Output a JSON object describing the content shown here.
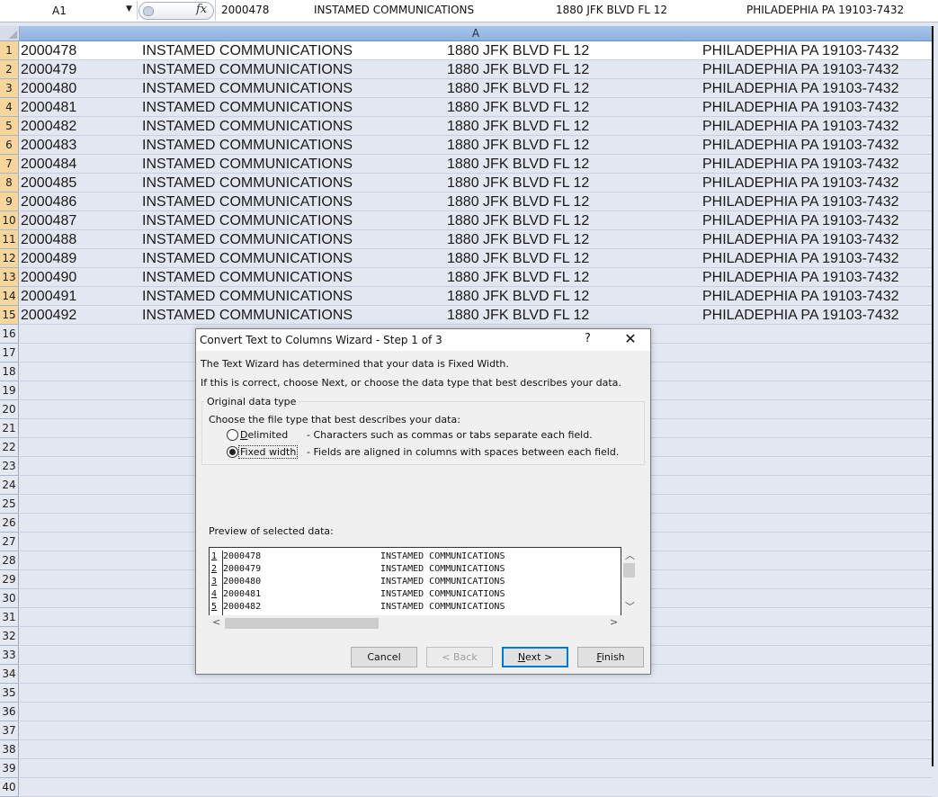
{
  "formula_bar": {
    "name_box": "A1",
    "fx_label": "fx",
    "content": {
      "id": "2000478",
      "company": "INSTAMED COMMUNICATIONS",
      "address": "1880 JFK BLVD FL 12",
      "city": "PHILADEPHIA PA 19103-7432"
    }
  },
  "sheet": {
    "column_header": "A",
    "row_numbers": [
      "1",
      "2",
      "3",
      "4",
      "5",
      "6",
      "7",
      "8",
      "9",
      "10",
      "11",
      "12",
      "13",
      "14",
      "15",
      "16",
      "17",
      "18",
      "19",
      "20",
      "21",
      "22",
      "23",
      "24",
      "25",
      "26",
      "27",
      "28",
      "29",
      "30",
      "31",
      "32",
      "33",
      "34",
      "35",
      "36",
      "37",
      "38",
      "39",
      "40"
    ],
    "rows": [
      {
        "id": "2000478",
        "company": "INSTAMED COMMUNICATIONS",
        "address": "1880 JFK BLVD FL 12",
        "city": "PHILADEPHIA PA 19103-7432"
      },
      {
        "id": "2000479",
        "company": "INSTAMED COMMUNICATIONS",
        "address": "1880 JFK BLVD FL 12",
        "city": "PHILADEPHIA PA 19103-7432"
      },
      {
        "id": "2000480",
        "company": "INSTAMED COMMUNICATIONS",
        "address": "1880 JFK BLVD FL 12",
        "city": "PHILADEPHIA PA 19103-7432"
      },
      {
        "id": "2000481",
        "company": "INSTAMED COMMUNICATIONS",
        "address": "1880 JFK BLVD FL 12",
        "city": "PHILADEPHIA PA 19103-7432"
      },
      {
        "id": "2000482",
        "company": "INSTAMED COMMUNICATIONS",
        "address": "1880 JFK BLVD FL 12",
        "city": "PHILADEPHIA PA 19103-7432"
      },
      {
        "id": "2000483",
        "company": "INSTAMED COMMUNICATIONS",
        "address": "1880 JFK BLVD FL 12",
        "city": "PHILADEPHIA PA 19103-7432"
      },
      {
        "id": "2000484",
        "company": "INSTAMED COMMUNICATIONS",
        "address": "1880 JFK BLVD FL 12",
        "city": "PHILADEPHIA PA 19103-7432"
      },
      {
        "id": "2000485",
        "company": "INSTAMED COMMUNICATIONS",
        "address": "1880 JFK BLVD FL 12",
        "city": "PHILADEPHIA PA 19103-7432"
      },
      {
        "id": "2000486",
        "company": "INSTAMED COMMUNICATIONS",
        "address": "1880 JFK BLVD FL 12",
        "city": "PHILADEPHIA PA 19103-7432"
      },
      {
        "id": "2000487",
        "company": "INSTAMED COMMUNICATIONS",
        "address": "1880 JFK BLVD FL 12",
        "city": "PHILADEPHIA PA 19103-7432"
      },
      {
        "id": "2000488",
        "company": "INSTAMED COMMUNICATIONS",
        "address": "1880 JFK BLVD FL 12",
        "city": "PHILADEPHIA PA 19103-7432"
      },
      {
        "id": "2000489",
        "company": "INSTAMED COMMUNICATIONS",
        "address": "1880 JFK BLVD FL 12",
        "city": "PHILADEPHIA PA 19103-7432"
      },
      {
        "id": "2000490",
        "company": "INSTAMED COMMUNICATIONS",
        "address": "1880 JFK BLVD FL 12",
        "city": "PHILADEPHIA PA 19103-7432"
      },
      {
        "id": "2000491",
        "company": "INSTAMED COMMUNICATIONS",
        "address": "1880 JFK BLVD FL 12",
        "city": "PHILADEPHIA PA 19103-7432"
      },
      {
        "id": "2000492",
        "company": "INSTAMED COMMUNICATIONS",
        "address": "1880 JFK BLVD FL 12",
        "city": "PHILADEPHIA PA 19103-7432"
      }
    ]
  },
  "dialog": {
    "title": "Convert Text to Columns Wizard - Step 1 of 3",
    "help_label": "?",
    "close_label": "✕",
    "intro_line1": "The Text Wizard has determined that your data is Fixed Width.",
    "intro_line2": "If this is correct, choose Next, or choose the data type that best describes your data.",
    "group_title": "Original data type",
    "group_prompt": "Choose the file type that best describes your data:",
    "option_delimited": {
      "label": "Delimited",
      "description": "- Characters such as commas or tabs separate each field.",
      "selected": false
    },
    "option_fixed": {
      "label": "Fixed width",
      "description": "- Fields are aligned in columns with spaces between each field.",
      "selected": true
    },
    "preview_label": "Preview of selected data:",
    "preview_rows": [
      {
        "num": "1",
        "id": "2000478",
        "company": "INSTAMED COMMUNICATIONS"
      },
      {
        "num": "2",
        "id": "2000479",
        "company": "INSTAMED COMMUNICATIONS"
      },
      {
        "num": "3",
        "id": "2000480",
        "company": "INSTAMED COMMUNICATIONS"
      },
      {
        "num": "4",
        "id": "2000481",
        "company": "INSTAMED COMMUNICATIONS"
      },
      {
        "num": "5",
        "id": "2000482",
        "company": "INSTAMED COMMUNICATIONS"
      }
    ],
    "buttons": {
      "cancel": "Cancel",
      "back": "< Back",
      "next": "Next >",
      "finish": "Finish"
    }
  },
  "colors": {
    "selected_row_header": "#f7d69c",
    "grid_bg": "#e2e7f1",
    "column_header_bg": "#a7c4e8",
    "default_button_border": "#0078d7"
  }
}
